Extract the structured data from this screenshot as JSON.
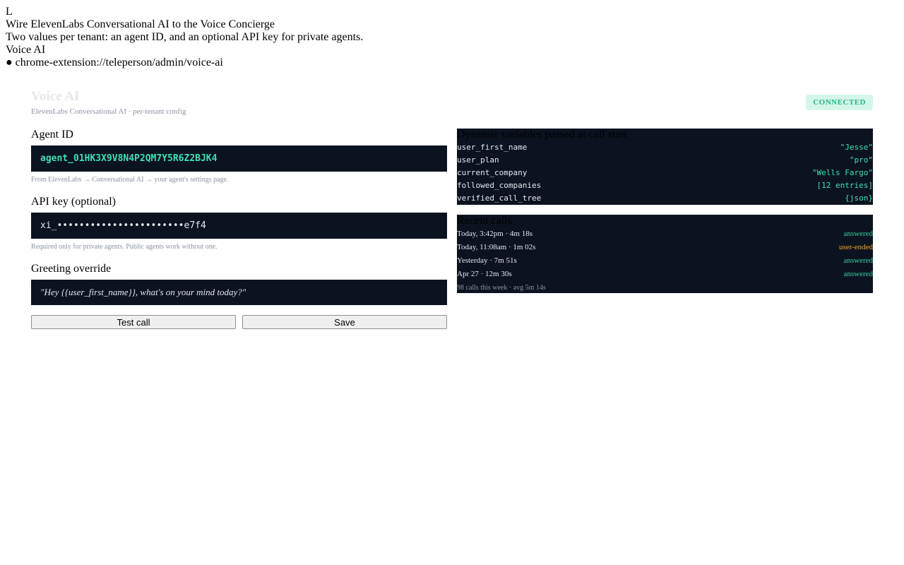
{
  "header": {
    "logo_letter": "L",
    "headline": "Wire ElevenLabs Conversational AI to the Voice Concierge",
    "subline": "Two values per tenant: an agent ID, and an optional API key for private agents.",
    "section": "Voice AI",
    "url_dot": "●",
    "url": "chrome-extension://teleperson/admin/voice-ai"
  },
  "panel": {
    "title": "Voice AI",
    "subtitle": "ElevenLabs Conversational AI · per-tenant config",
    "status": "CONNECTED"
  },
  "form": {
    "agent_label": "Agent ID",
    "agent_value": "agent_01HK3X9V8N4P2QM7Y5R6Z2BJK4",
    "agent_hint": "From ElevenLabs → Conversational AI → your agent's settings page.",
    "api_label": "API key (optional)",
    "api_value": "xi_•••••••••••••••••••••••e7f4",
    "api_hint": "Required only for private agents. Public agents work without one.",
    "greeting_label": "Greeting override",
    "greeting_value": "\"Hey {{user_first_name}}, what's on your mind today?\"",
    "test_button": "Test call",
    "save_button": "Save"
  },
  "variables": {
    "title": "Dynamic variables passed at call start",
    "items": [
      {
        "key": "user_first_name",
        "value": "\"Jesse\""
      },
      {
        "key": "user_plan",
        "value": "\"pro\""
      },
      {
        "key": "current_company",
        "value": "\"Wells Fargo\""
      },
      {
        "key": "followed_companies",
        "value": "[12 entries]"
      },
      {
        "key": "verified_call_tree",
        "value": "{json}"
      }
    ]
  },
  "calls": {
    "title": "Recent calls",
    "items": [
      {
        "when": "Today, 3:42pm · 4m 18s",
        "status": "answered"
      },
      {
        "when": "Today, 11:08am · 1m 02s",
        "status": "user-ended"
      },
      {
        "when": "Yesterday · 7m 51s",
        "status": "answered"
      },
      {
        "when": "Apr 27 · 12m 30s",
        "status": "answered"
      }
    ],
    "footer": "98 calls this week · avg 5m 14s"
  },
  "colors": {
    "dark_bg": "#0c1320",
    "accent_teal": "#3ee0b3",
    "status_amber": "#f5a623",
    "badge_bg": "#d3f6e8"
  }
}
